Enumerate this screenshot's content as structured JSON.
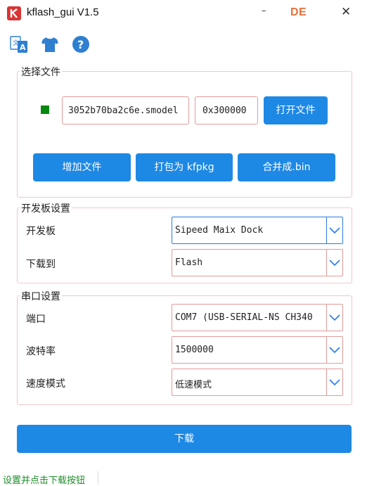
{
  "window": {
    "title": "kflash_gui V1.5",
    "minimize_glyph": "–",
    "language_badge": "DE",
    "close_glyph": "✕"
  },
  "toolbar": {
    "icons": [
      "language-translate-icon",
      "theme-shirt-icon",
      "help-icon"
    ]
  },
  "file_group": {
    "title": "选择文件",
    "status_color": "#06870f",
    "file_path_value": "3052b70ba2c6e.smodel",
    "address_value": "0x300000",
    "open_file_label": "打开文件",
    "add_file_label": "增加文件",
    "pack_label": "打包为 kfpkg",
    "merge_label": "合并成.bin"
  },
  "board_group": {
    "title": "开发板设置",
    "board_label": "开发板",
    "board_value": "Sipeed Maix Dock",
    "download_to_label": "下载到",
    "download_to_value": "Flash"
  },
  "serial_group": {
    "title": "串口设置",
    "port_label": "端口",
    "port_value": "COM7 (USB-SERIAL-NS CH340",
    "baud_label": "波特率",
    "baud_value": "1500000",
    "speed_label": "速度模式",
    "speed_value": "低速模式"
  },
  "download_button_label": "下载",
  "status_bar_text": "设置并点击下载按钮",
  "colors": {
    "accent": "#1e88e5",
    "group_border": "#f1c8c8",
    "input_border": "#e39a9a",
    "focus_border": "#2c7be5",
    "status_green": "#1d8f2a",
    "language_badge": "#e8703c"
  }
}
